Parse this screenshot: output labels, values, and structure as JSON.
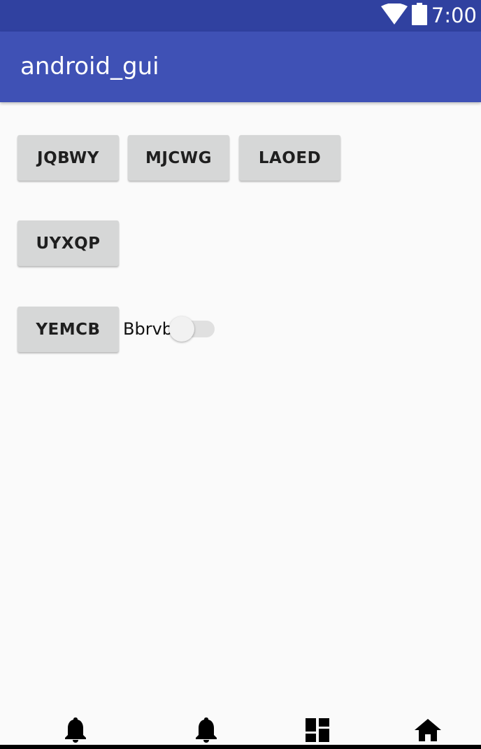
{
  "status_bar": {
    "time": "7:00",
    "icons": [
      "wifi-icon",
      "battery-icon"
    ]
  },
  "app_bar": {
    "title": "android_gui"
  },
  "buttons": {
    "jqbwy": "JQBWY",
    "mjcwg": "MJCWG",
    "laoed": "LAOED",
    "uyxqp": "UYXQP",
    "yemcb": "YEMCB"
  },
  "switch": {
    "label": "Bbrvb",
    "checked": false
  },
  "bottom_nav": {
    "items": [
      "bell-icon",
      "bell-icon",
      "dashboard-icon",
      "home-icon"
    ]
  },
  "colors": {
    "status_bar": "#3041a0",
    "app_bar": "#3f51b5",
    "button": "#d6d7d7",
    "background": "#fafafa"
  }
}
